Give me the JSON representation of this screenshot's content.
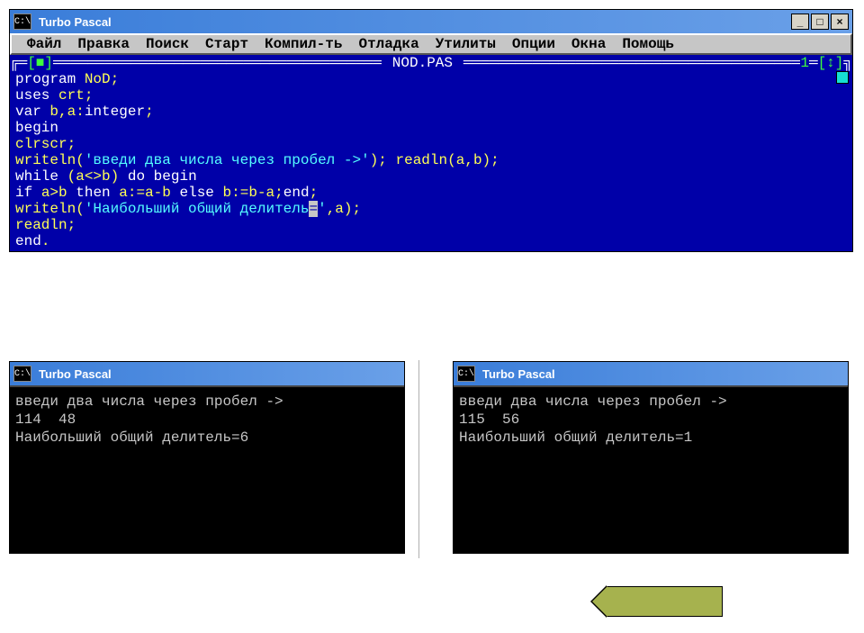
{
  "app": {
    "title": "Turbo Pascal",
    "icon_label": "C:\\"
  },
  "window_controls": {
    "minimize": "_",
    "maximize": "□",
    "close": "×"
  },
  "menu": {
    "items": [
      "Файл",
      "Правка",
      "Поиск",
      "Старт",
      "Компил-ть",
      "Отладка",
      "Утилиты",
      "Опции",
      "Окна",
      "Помощь"
    ]
  },
  "editor": {
    "filename": "NOD.PAS",
    "window_number": "1",
    "close_mark": "[■]",
    "scroll_mark": "[↕]",
    "lines": [
      [
        {
          "t": "program ",
          "c": "kw"
        },
        {
          "t": "NoD",
          "c": "ident"
        },
        {
          "t": ";",
          "c": "sym"
        }
      ],
      [
        {
          "t": "uses ",
          "c": "kw"
        },
        {
          "t": "crt",
          "c": "ident"
        },
        {
          "t": ";",
          "c": "sym"
        }
      ],
      [
        {
          "t": "var ",
          "c": "kw"
        },
        {
          "t": "b",
          "c": "ident"
        },
        {
          "t": ",",
          "c": "sym"
        },
        {
          "t": "a",
          "c": "ident"
        },
        {
          "t": ":",
          "c": "sym"
        },
        {
          "t": "integer",
          "c": "kw"
        },
        {
          "t": ";",
          "c": "sym"
        }
      ],
      [
        {
          "t": "begin",
          "c": "kw"
        }
      ],
      [
        {
          "t": "clrscr",
          "c": "ident"
        },
        {
          "t": ";",
          "c": "sym"
        }
      ],
      [
        {
          "t": "writeln",
          "c": "ident"
        },
        {
          "t": "(",
          "c": "sym"
        },
        {
          "t": "'введи два числа через пробел ->'",
          "c": "str"
        },
        {
          "t": "); ",
          "c": "sym"
        },
        {
          "t": "readln",
          "c": "ident"
        },
        {
          "t": "(",
          "c": "sym"
        },
        {
          "t": "a",
          "c": "ident"
        },
        {
          "t": ",",
          "c": "sym"
        },
        {
          "t": "b",
          "c": "ident"
        },
        {
          "t": ");",
          "c": "sym"
        }
      ],
      [
        {
          "t": "while ",
          "c": "kw"
        },
        {
          "t": "(",
          "c": "sym"
        },
        {
          "t": "a",
          "c": "ident"
        },
        {
          "t": "<>",
          "c": "sym"
        },
        {
          "t": "b",
          "c": "ident"
        },
        {
          "t": ") ",
          "c": "sym"
        },
        {
          "t": "do ",
          "c": "kw"
        },
        {
          "t": "begin",
          "c": "kw"
        }
      ],
      [
        {
          "t": "if ",
          "c": "kw"
        },
        {
          "t": "a",
          "c": "ident"
        },
        {
          "t": ">",
          "c": "sym"
        },
        {
          "t": "b",
          "c": "ident"
        },
        {
          "t": " then ",
          "c": "kw"
        },
        {
          "t": "a",
          "c": "ident"
        },
        {
          "t": ":=",
          "c": "sym"
        },
        {
          "t": "a",
          "c": "ident"
        },
        {
          "t": "-",
          "c": "sym"
        },
        {
          "t": "b",
          "c": "ident"
        },
        {
          "t": " else ",
          "c": "kw"
        },
        {
          "t": "b",
          "c": "ident"
        },
        {
          "t": ":=",
          "c": "sym"
        },
        {
          "t": "b",
          "c": "ident"
        },
        {
          "t": "-",
          "c": "sym"
        },
        {
          "t": "a",
          "c": "ident"
        },
        {
          "t": ";",
          "c": "sym"
        },
        {
          "t": "end",
          "c": "kw"
        },
        {
          "t": ";",
          "c": "sym"
        }
      ],
      [
        {
          "t": "writeln",
          "c": "ident"
        },
        {
          "t": "(",
          "c": "sym"
        },
        {
          "t": "'Наибольший общий делитель",
          "c": "str"
        },
        {
          "t": "=",
          "c": "cursor-block"
        },
        {
          "t": "'",
          "c": "str"
        },
        {
          "t": ",",
          "c": "sym"
        },
        {
          "t": "a",
          "c": "ident"
        },
        {
          "t": ");",
          "c": "sym"
        }
      ],
      [
        {
          "t": "readln",
          "c": "ident"
        },
        {
          "t": ";",
          "c": "sym"
        }
      ],
      [
        {
          "t": "end",
          "c": "kw"
        },
        {
          "t": ".",
          "c": "sym"
        }
      ]
    ]
  },
  "outputs": {
    "left": "введи два числа через пробел ->\n114  48\nНаибольший общий делитель=6",
    "right": "введи два числа через пробел ->\n115  56\nНаибольший общий делитель=1"
  }
}
